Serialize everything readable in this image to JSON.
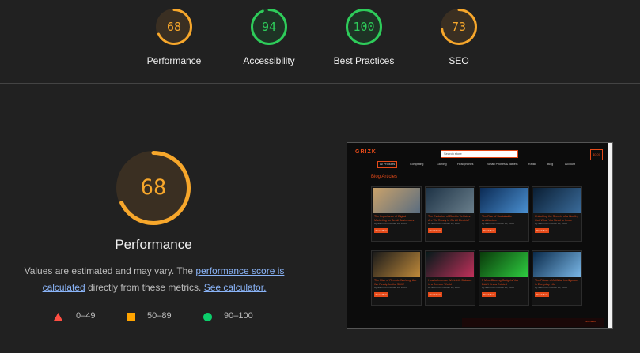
{
  "summary": [
    {
      "score": "68",
      "fraction": 0.68,
      "label": "Performance",
      "color": "#f7a72b",
      "track": "#3a2f22"
    },
    {
      "score": "94",
      "fraction": 0.94,
      "label": "Accessibility",
      "color": "#2ecc5a",
      "track": "#1e3325"
    },
    {
      "score": "100",
      "fraction": 1.0,
      "label": "Best Practices",
      "color": "#2ecc5a",
      "track": "#1e3325"
    },
    {
      "score": "73",
      "fraction": 0.73,
      "label": "SEO",
      "color": "#f7a72b",
      "track": "#3a2f22"
    }
  ],
  "performance": {
    "score": "68",
    "fraction": 0.68,
    "title": "Performance",
    "color": "#f7a72b",
    "desc_prefix": "Values are estimated and may vary. The ",
    "desc_link": "performance score is calculated",
    "desc_middle": " directly from these metrics. ",
    "desc_link2": "See calculator."
  },
  "legend": [
    {
      "icon": "triangle-icon",
      "label": "0–49",
      "color": "#ff4e42"
    },
    {
      "icon": "square-icon",
      "label": "50–89",
      "color": "#ffa400"
    },
    {
      "icon": "circle-icon",
      "label": "90–100",
      "color": "#0cce6b"
    }
  ],
  "screenshot": {
    "logo": "GRIZK",
    "search_placeholder": "Search store",
    "cart": "$0.00",
    "menu": [
      "All Products",
      "Computing",
      "Gaming",
      "Headphones",
      "Smart Phones & Tablets",
      "Radio",
      "Blog",
      "Account"
    ],
    "section_title": "Blog Articles",
    "cards": [
      {
        "title": "The Importance of Digital Marketing for Small Businesses",
        "meta": "By admin on October 20, 2024",
        "button": "Read More",
        "c1": "#caa26a",
        "c2": "#5a6d80"
      },
      {
        "title": "The Evolution of Electric Vehicles: Are We Ready to Go All Electric?",
        "meta": "By admin on October 20, 2024",
        "button": "Read More",
        "c1": "#1e3346",
        "c2": "#6a7f8c"
      },
      {
        "title": "The Rise of Sustainable Architecture",
        "meta": "By admin on October 20, 2024",
        "button": "Read More",
        "c1": "#0b2b55",
        "c2": "#4a8fd0"
      },
      {
        "title": "Unlocking the Secrets of a Healthy Gut: What You Need to Know",
        "meta": "By admin on October 20, 2024",
        "button": "Read More",
        "c1": "#0a1e33",
        "c2": "#3a6b9a"
      },
      {
        "title": "The Rise of Remote Working: Are We Ready for the Shift?",
        "meta": "By admin on October 20, 2024",
        "button": "Read More",
        "c1": "#1a1a1a",
        "c2": "#c08a3a"
      },
      {
        "title": "How to Improve Work-Life Balance in a Remote World",
        "meta": "By admin on October 20, 2024",
        "button": "Read More",
        "c1": "#061a1a",
        "c2": "#c0305a"
      },
      {
        "title": "5 Mind-Blowing Gadgets You Didn't Know Existed",
        "meta": "By admin on October 20, 2024",
        "button": "Read More",
        "c1": "#0a3a0a",
        "c2": "#2ecc40"
      },
      {
        "title": "The Future of Artificial Intelligence in Everyday Life",
        "meta": "By admin on October 20, 2024",
        "button": "Read More",
        "c1": "#0a2a4a",
        "c2": "#7ab8e8"
      }
    ],
    "footer": "Information"
  }
}
